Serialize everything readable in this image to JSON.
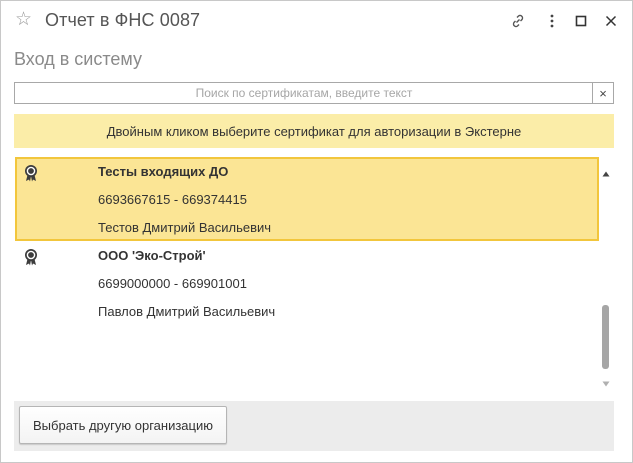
{
  "window": {
    "title": "Отчет в ФНС 0087"
  },
  "header": {
    "subtitle": "Вход в систему"
  },
  "search": {
    "placeholder": "Поиск по сертификатам, введите текст",
    "value": "",
    "clear_label": "×"
  },
  "banner": {
    "text": "Двойным кликом выберите сертификат для авторизации в Экстерне"
  },
  "certificates": [
    {
      "organization": "Тесты входящих ДО",
      "inn_kpp": "6693667615 - 669374415",
      "person": "Тестов Дмитрий Васильевич",
      "selected": true
    },
    {
      "organization": "ООО 'Эко-Строй'",
      "inn_kpp": "6699000000 - 669901001",
      "person": "Павлов Дмитрий Васильевич",
      "selected": false
    }
  ],
  "footer": {
    "choose_org_label": "Выбрать другую организацию"
  },
  "colors": {
    "banner_bg": "#fbeda8",
    "selected_bg": "#fbe595",
    "selected_border": "#f2c63c"
  },
  "icons": {
    "favorite": "star-icon",
    "link": "link-icon",
    "more": "more-vertical-icon",
    "maximize": "maximize-icon",
    "close": "close-icon",
    "certificate": "certificate-icon"
  }
}
